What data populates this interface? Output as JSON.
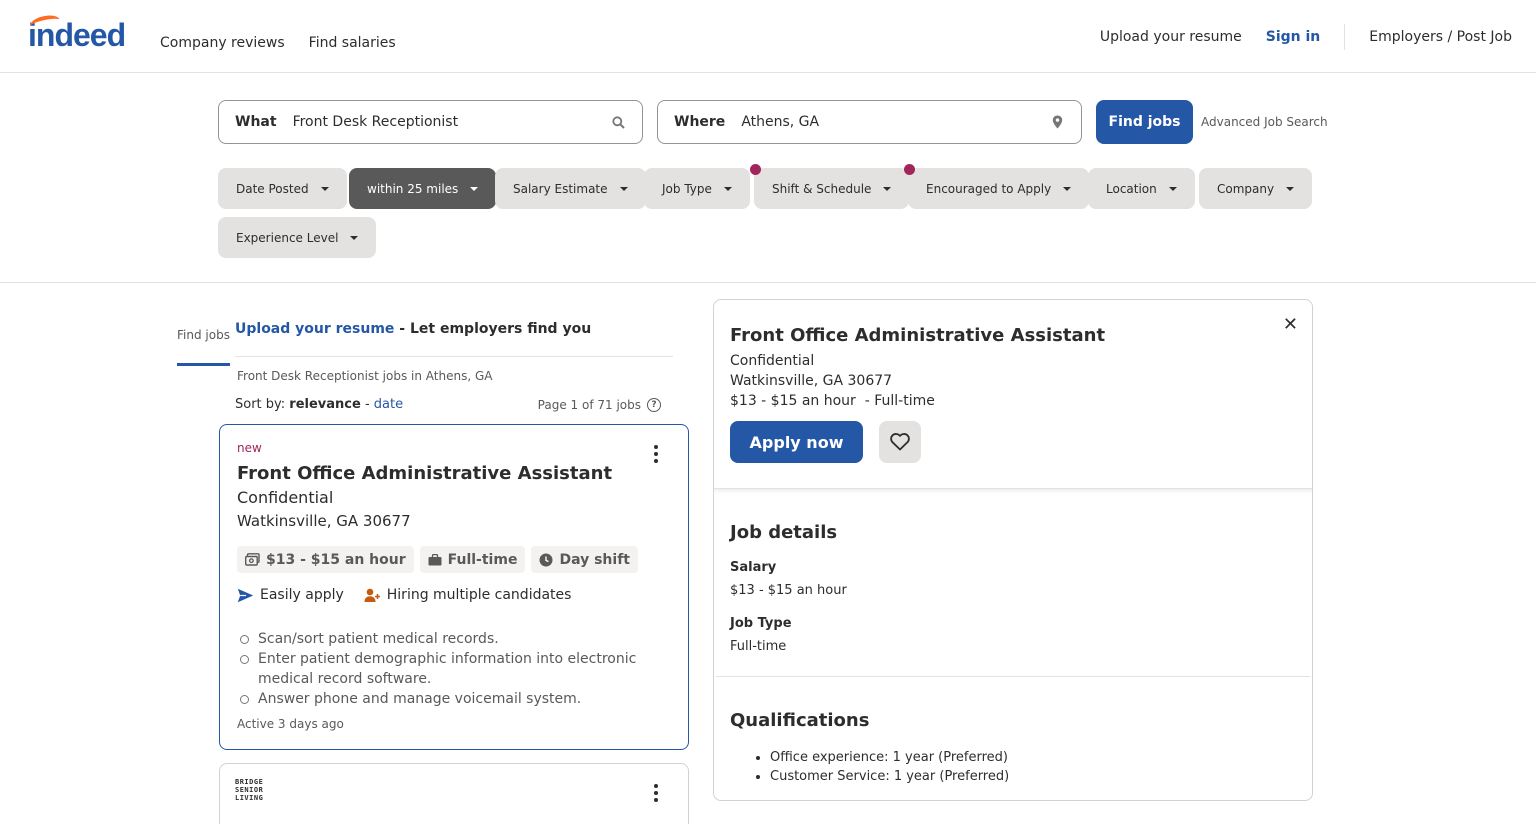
{
  "brand": {
    "logo": "indeed",
    "primary": "#2557a7",
    "accent": "#a2255a"
  },
  "nav": {
    "find_jobs": "Find jobs",
    "company_reviews": "Company reviews",
    "find_salaries": "Find salaries"
  },
  "header_right": {
    "upload": "Upload your resume",
    "signin": "Sign in",
    "employers": "Employers / Post Job"
  },
  "search": {
    "what_label": "What",
    "what_value": "Front Desk Receptionist",
    "where_label": "Where",
    "where_value": "Athens, GA",
    "find_button": "Find jobs",
    "advanced": "Advanced Job Search"
  },
  "filters": {
    "date_posted": "Date Posted",
    "distance": "within 25 miles",
    "salary": "Salary Estimate",
    "job_type": "Job Type",
    "shift": "Shift & Schedule",
    "encouraged": "Encouraged to Apply",
    "location": "Location",
    "company": "Company",
    "experience": "Experience Level"
  },
  "results": {
    "upload_link": "Upload your resume",
    "upload_rest": " - Let employers find you",
    "breadcrumb": "Front Desk Receptionist jobs in Athens, GA",
    "sort_prefix": "Sort by: ",
    "sort_relevance": "relevance",
    "sort_sep": " - ",
    "sort_date": "date",
    "page_count": "Page 1 of 71 jobs"
  },
  "job_card": {
    "tag": "new",
    "title": "Front Office Administrative Assistant",
    "company": "Confidential",
    "location": "Watkinsville, GA 30677",
    "salary_chip": "$13 - $15 an hour",
    "type_chip": "Full-time",
    "shift_chip": "Day shift",
    "easily_apply": "Easily apply",
    "hiring": "Hiring multiple candidates",
    "bullets": [
      "Scan/sort patient medical records.",
      "Enter patient demographic information into electronic medical record software.",
      "Answer phone and manage voicemail system."
    ],
    "active": "Active 3 days ago"
  },
  "job_card2": {
    "logo_text": [
      "BRIDGE",
      "SENIOR",
      "LIVING"
    ]
  },
  "detail": {
    "title": "Front Office Administrative Assistant",
    "company": "Confidential",
    "location": "Watkinsville, GA 30677",
    "salary_line": "$13 - $15 an hour  - Full-time",
    "apply": "Apply now",
    "job_details_title": "Job details",
    "salary_label": "Salary",
    "salary_value": "$13 - $15 an hour",
    "job_type_label": "Job Type",
    "job_type_value": "Full-time",
    "qualifications_title": "Qualifications",
    "qualifications": [
      "Office experience: 1 year (Preferred)",
      "Customer Service: 1 year (Preferred)"
    ]
  }
}
